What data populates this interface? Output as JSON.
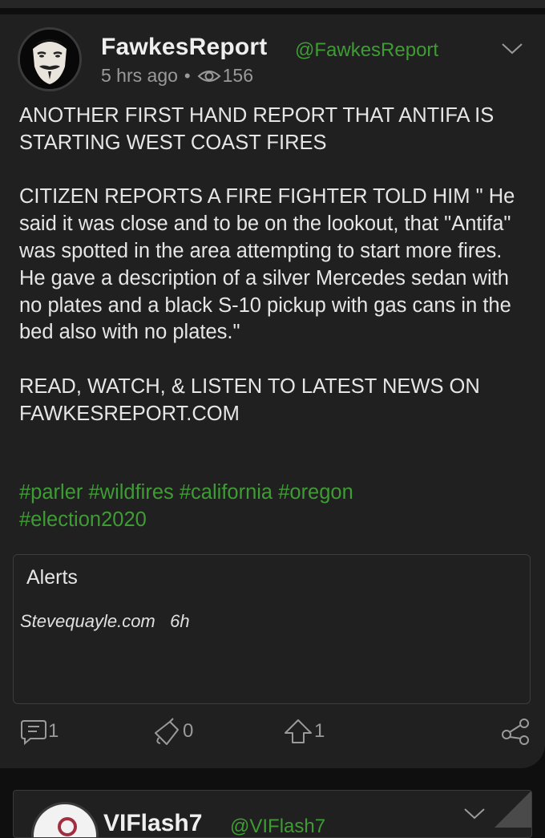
{
  "post": {
    "username": "FawkesReport",
    "handle": "@FawkesReport",
    "time": "5 hrs ago",
    "separator": "•",
    "views": "156",
    "body": "ANOTHER FIRST HAND REPORT THAT ANTIFA IS STARTING WEST COAST FIRES\n\nCITIZEN REPORTS A FIRE FIGHTER TOLD HIM \" He said it was close and to be on the lookout, that \"Antifa\" was spotted in the area attempting to start more fires. He gave a description of a silver Mercedes sedan with no plates and a black S-10 pickup with gas cans in the bed also with no plates.\"\n\nREAD, WATCH, & LISTEN TO LATEST NEWS ON FAWKESREPORT.COM",
    "hashtags": [
      "#parler",
      "#wildfires",
      "#california",
      "#oregon",
      "#election2020"
    ],
    "embed": {
      "title": "Alerts",
      "source": "Stevequayle.com",
      "age": "6h"
    },
    "actions": {
      "comments": "1",
      "echoes": "0",
      "upvotes": "1"
    }
  },
  "next_post": {
    "username": "VIFlash7",
    "handle": "@VIFlash7"
  },
  "colors": {
    "accent_green": "#3f9c35",
    "card_bg": "#202020",
    "page_bg": "#0f0f0f",
    "muted": "#9a9a9a"
  },
  "icons": [
    "avatar-guy-fawkes-mask",
    "eye-icon",
    "chevron-down-icon",
    "comment-icon",
    "echo-megaphone-icon",
    "upvote-arrow-icon",
    "share-icon"
  ]
}
